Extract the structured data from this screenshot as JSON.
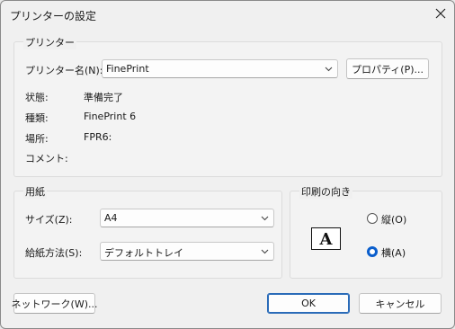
{
  "window": {
    "title": "プリンターの設定",
    "close_icon": "close-icon"
  },
  "printer_group": {
    "label": "プリンター",
    "name_label": "プリンター名(N):",
    "name_value": "FinePrint",
    "properties_button": "プロパティ(P)...",
    "status_label": "状態:",
    "status_value": "準備完了",
    "type_label": "種類:",
    "type_value": "FinePrint 6",
    "location_label": "場所:",
    "location_value": "FPR6:",
    "comment_label": "コメント:",
    "comment_value": ""
  },
  "paper_group": {
    "label": "用紙",
    "size_label": "サイズ(Z):",
    "size_value": "A4",
    "source_label": "給紙方法(S):",
    "source_value": "デフォルトトレイ"
  },
  "orientation_group": {
    "label": "印刷の向き",
    "preview_letter": "A",
    "portrait_label": "縦(O)",
    "landscape_label": "横(A)",
    "selected": "landscape"
  },
  "footer": {
    "network_button": "ネットワーク(W)...",
    "ok_button": "OK",
    "cancel_button": "キャンセル"
  },
  "colors": {
    "accent": "#0a5ecc"
  }
}
